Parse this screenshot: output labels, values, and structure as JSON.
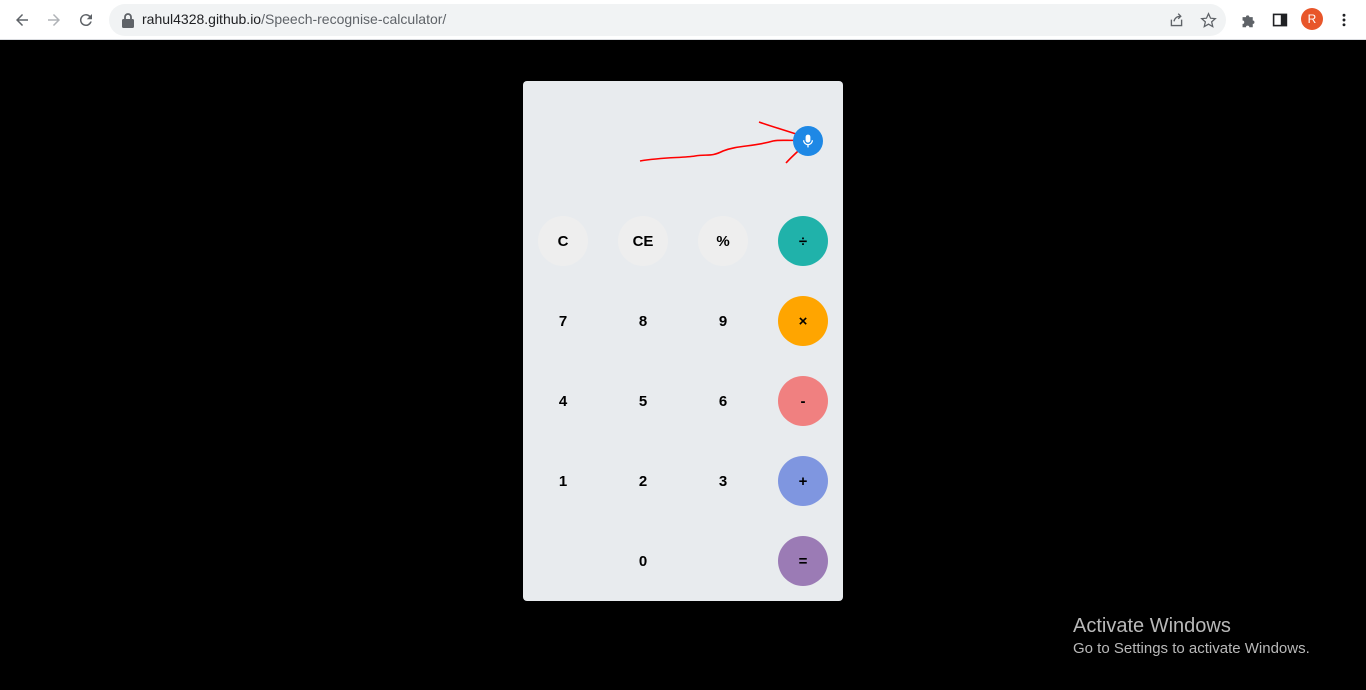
{
  "browser": {
    "url_host": "rahul4328.github.io",
    "url_path": "/Speech-recognise-calculator/",
    "profile_initial": "R"
  },
  "calculator": {
    "colors": {
      "panel": "#e8ebee",
      "mic": "#1e88e5",
      "divide": "#20b2aa",
      "multiply": "#ffa500",
      "subtract": "#f08080",
      "add": "#7f96e0",
      "equals": "#9b7bb5",
      "annotation": "#ff0000"
    },
    "row1": [
      "C",
      "CE",
      "%",
      "÷"
    ],
    "row2": [
      "7",
      "8",
      "9",
      "×"
    ],
    "row3": [
      "4",
      "5",
      "6",
      "-"
    ],
    "row4": [
      "1",
      "2",
      "3",
      "+"
    ],
    "row5": [
      "0",
      "="
    ]
  },
  "watermark": {
    "title": "Activate Windows",
    "subtitle": "Go to Settings to activate Windows."
  }
}
